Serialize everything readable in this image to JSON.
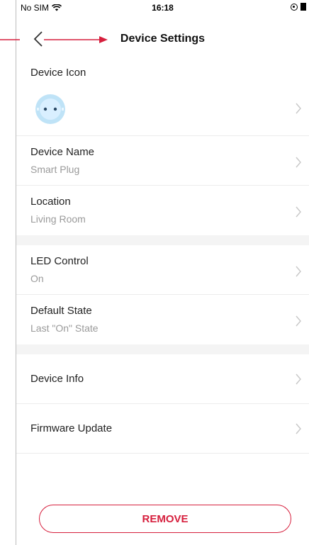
{
  "status": {
    "carrier": "No SIM",
    "time": "16:18"
  },
  "nav": {
    "title": "Device Settings"
  },
  "settings": {
    "device_icon_label": "Device Icon",
    "device_name_label": "Device Name",
    "device_name_value": "Smart Plug",
    "location_label": "Location",
    "location_value": "Living Room",
    "led_label": "LED Control",
    "led_value": "On",
    "default_state_label": "Default State",
    "default_state_value": "Last \"On\" State",
    "device_info_label": "Device Info",
    "firmware_label": "Firmware Update"
  },
  "actions": {
    "remove_label": "REMOVE"
  },
  "colors": {
    "accent": "#d61f3d",
    "plug_icon": "#bfe3f7",
    "separator": "#f4f4f4"
  }
}
